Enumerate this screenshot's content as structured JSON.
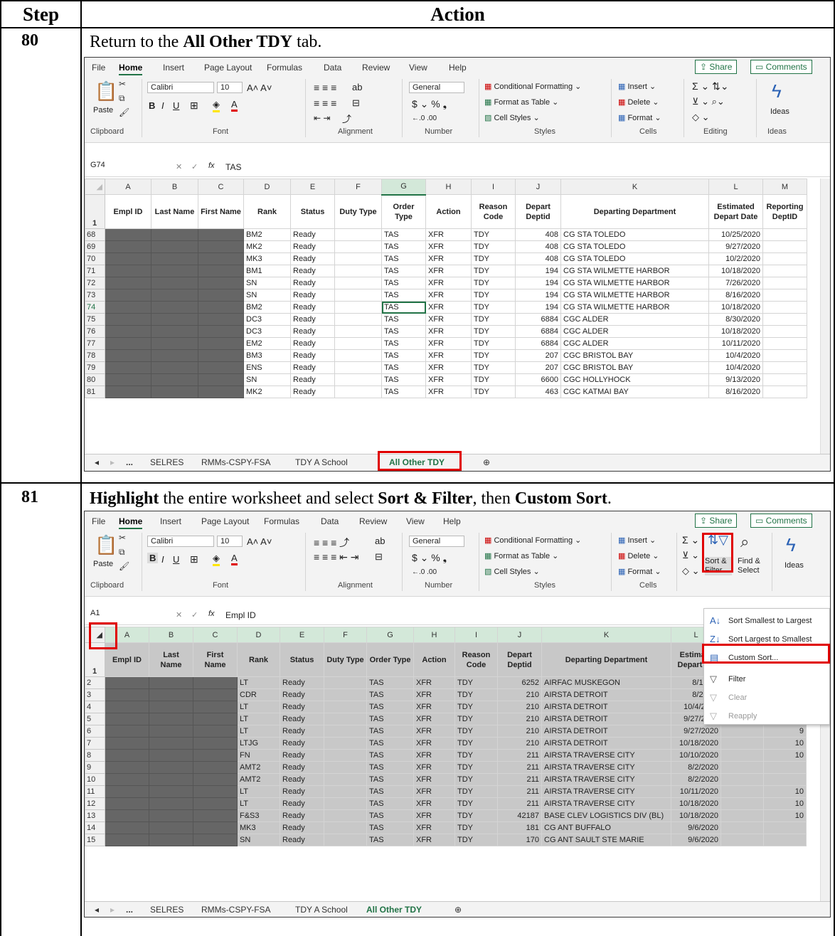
{
  "table_header": {
    "step": "Step",
    "action": "Action"
  },
  "step80": {
    "number": "80",
    "instruction": {
      "pre": "Return to the ",
      "bold": "All Other TDY",
      "post": " tab."
    },
    "excel": {
      "menu": [
        "File",
        "Home",
        "Insert",
        "Page Layout",
        "Formulas",
        "Data",
        "Review",
        "View",
        "Help"
      ],
      "share": "Share",
      "comments": "Comments",
      "ribbon": {
        "paste": "Paste",
        "font_name": "Calibri",
        "font_size": "10",
        "number_format": "General",
        "cond_format": "Conditional Formatting",
        "format_table": "Format as Table",
        "cell_styles": "Cell Styles",
        "insert": "Insert",
        "delete": "Delete",
        "format": "Format",
        "ideas": "Ideas",
        "groups": [
          "Clipboard",
          "Font",
          "Alignment",
          "Number",
          "Styles",
          "Cells",
          "Editing",
          "Ideas"
        ]
      },
      "name_box": "G74",
      "formula": "TAS",
      "col_letters": [
        "A",
        "B",
        "C",
        "D",
        "E",
        "F",
        "G",
        "H",
        "I",
        "J",
        "K",
        "L",
        "M"
      ],
      "headers": [
        "Empl ID",
        "Last Name",
        "First Name",
        "Rank",
        "Status",
        "Duty Type",
        "Order Type",
        "Action",
        "Reason Code",
        "Depart Deptid",
        "Departing Department",
        "Estimated Depart Date",
        "Reporting DeptID"
      ],
      "header_row_num": "1",
      "rows": [
        {
          "n": "68",
          "rank": "BM2",
          "status": "Ready",
          "order": "TAS",
          "action": "XFR",
          "reason": "TDY",
          "deptid": "408",
          "dept": "CG STA TOLEDO",
          "date": "10/25/2020"
        },
        {
          "n": "69",
          "rank": "MK2",
          "status": "Ready",
          "order": "TAS",
          "action": "XFR",
          "reason": "TDY",
          "deptid": "408",
          "dept": "CG STA TOLEDO",
          "date": "9/27/2020"
        },
        {
          "n": "70",
          "rank": "MK3",
          "status": "Ready",
          "order": "TAS",
          "action": "XFR",
          "reason": "TDY",
          "deptid": "408",
          "dept": "CG STA TOLEDO",
          "date": "10/2/2020"
        },
        {
          "n": "71",
          "rank": "BM1",
          "status": "Ready",
          "order": "TAS",
          "action": "XFR",
          "reason": "TDY",
          "deptid": "194",
          "dept": "CG STA WILMETTE HARBOR",
          "date": "10/18/2020"
        },
        {
          "n": "72",
          "rank": "SN",
          "status": "Ready",
          "order": "TAS",
          "action": "XFR",
          "reason": "TDY",
          "deptid": "194",
          "dept": "CG STA WILMETTE HARBOR",
          "date": "7/26/2020"
        },
        {
          "n": "73",
          "rank": "SN",
          "status": "Ready",
          "order": "TAS",
          "action": "XFR",
          "reason": "TDY",
          "deptid": "194",
          "dept": "CG STA WILMETTE HARBOR",
          "date": "8/16/2020"
        },
        {
          "n": "74",
          "rank": "BM2",
          "status": "Ready",
          "order": "TAS",
          "action": "XFR",
          "reason": "TDY",
          "deptid": "194",
          "dept": "CG STA WILMETTE HARBOR",
          "date": "10/18/2020"
        },
        {
          "n": "75",
          "rank": "DC3",
          "status": "Ready",
          "order": "TAS",
          "action": "XFR",
          "reason": "TDY",
          "deptid": "6884",
          "dept": "CGC ALDER",
          "date": "8/30/2020"
        },
        {
          "n": "76",
          "rank": "DC3",
          "status": "Ready",
          "order": "TAS",
          "action": "XFR",
          "reason": "TDY",
          "deptid": "6884",
          "dept": "CGC ALDER",
          "date": "10/18/2020"
        },
        {
          "n": "77",
          "rank": "EM2",
          "status": "Ready",
          "order": "TAS",
          "action": "XFR",
          "reason": "TDY",
          "deptid": "6884",
          "dept": "CGC ALDER",
          "date": "10/11/2020"
        },
        {
          "n": "78",
          "rank": "BM3",
          "status": "Ready",
          "order": "TAS",
          "action": "XFR",
          "reason": "TDY",
          "deptid": "207",
          "dept": "CGC BRISTOL BAY",
          "date": "10/4/2020"
        },
        {
          "n": "79",
          "rank": "ENS",
          "status": "Ready",
          "order": "TAS",
          "action": "XFR",
          "reason": "TDY",
          "deptid": "207",
          "dept": "CGC BRISTOL BAY",
          "date": "10/4/2020"
        },
        {
          "n": "80",
          "rank": "SN",
          "status": "Ready",
          "order": "TAS",
          "action": "XFR",
          "reason": "TDY",
          "deptid": "6600",
          "dept": "CGC HOLLYHOCK",
          "date": "9/13/2020"
        },
        {
          "n": "81",
          "rank": "MK2",
          "status": "Ready",
          "order": "TAS",
          "action": "XFR",
          "reason": "TDY",
          "deptid": "463",
          "dept": "CGC KATMAI BAY",
          "date": "8/16/2020"
        }
      ],
      "tabs": [
        "...",
        "SELRES",
        "RMMs-CSPY-FSA",
        "TDY A School",
        "All Other TDY"
      ]
    }
  },
  "step81": {
    "number": "81",
    "instruction": {
      "b1": "Highlight",
      "t1": " the entire worksheet and select ",
      "b2": "Sort & Filter",
      "t2": ", then ",
      "b3": "Custom Sort",
      "t3": "."
    },
    "excel": {
      "name_box": "A1",
      "formula": "Empl ID",
      "sort_filter": "Sort & Filter",
      "find_select": "Find & Select",
      "dropdown": [
        {
          "label": "Sort Smallest to Largest",
          "icon": "sort-asc-icon",
          "glyph": "A↓"
        },
        {
          "label": "Sort Largest to Smallest",
          "icon": "sort-desc-icon",
          "glyph": "Z↓"
        },
        {
          "label": "Custom Sort...",
          "icon": "custom-sort-icon",
          "glyph": "▤"
        },
        {
          "label": "Filter",
          "icon": "filter-icon",
          "glyph": "▽"
        },
        {
          "label": "Clear",
          "icon": "clear-filter-icon",
          "glyph": "▽"
        },
        {
          "label": "Reapply",
          "icon": "reapply-icon",
          "glyph": "▽"
        }
      ],
      "header_l": "Estimate Depart Da",
      "rows": [
        {
          "n": "2",
          "rank": "LT",
          "status": "Ready",
          "order": "TAS",
          "action": "XFR",
          "reason": "TDY",
          "deptid": "6252",
          "dept": "AIRFAC MUSKEGON",
          "date": "8/16/20",
          "m": ""
        },
        {
          "n": "3",
          "rank": "CDR",
          "status": "Ready",
          "order": "TAS",
          "action": "XFR",
          "reason": "TDY",
          "deptid": "210",
          "dept": "AIRSTA DETROIT",
          "date": "8/21/20",
          "m": ""
        },
        {
          "n": "4",
          "rank": "LT",
          "status": "Ready",
          "order": "TAS",
          "action": "XFR",
          "reason": "TDY",
          "deptid": "210",
          "dept": "AIRSTA DETROIT",
          "date": "10/4/2020",
          "m": "1"
        },
        {
          "n": "5",
          "rank": "LT",
          "status": "Ready",
          "order": "TAS",
          "action": "XFR",
          "reason": "TDY",
          "deptid": "210",
          "dept": "AIRSTA DETROIT",
          "date": "9/27/2020",
          "m": "9"
        },
        {
          "n": "6",
          "rank": "LT",
          "status": "Ready",
          "order": "TAS",
          "action": "XFR",
          "reason": "TDY",
          "deptid": "210",
          "dept": "AIRSTA DETROIT",
          "date": "9/27/2020",
          "m": "9"
        },
        {
          "n": "7",
          "rank": "LTJG",
          "status": "Ready",
          "order": "TAS",
          "action": "XFR",
          "reason": "TDY",
          "deptid": "210",
          "dept": "AIRSTA DETROIT",
          "date": "10/18/2020",
          "m": "10"
        },
        {
          "n": "8",
          "rank": "FN",
          "status": "Ready",
          "order": "TAS",
          "action": "XFR",
          "reason": "TDY",
          "deptid": "211",
          "dept": "AIRSTA TRAVERSE CITY",
          "date": "10/10/2020",
          "m": "10"
        },
        {
          "n": "9",
          "rank": "AMT2",
          "status": "Ready",
          "order": "TAS",
          "action": "XFR",
          "reason": "TDY",
          "deptid": "211",
          "dept": "AIRSTA TRAVERSE CITY",
          "date": "8/2/2020",
          "m": ""
        },
        {
          "n": "10",
          "rank": "AMT2",
          "status": "Ready",
          "order": "TAS",
          "action": "XFR",
          "reason": "TDY",
          "deptid": "211",
          "dept": "AIRSTA TRAVERSE CITY",
          "date": "8/2/2020",
          "m": ""
        },
        {
          "n": "11",
          "rank": "LT",
          "status": "Ready",
          "order": "TAS",
          "action": "XFR",
          "reason": "TDY",
          "deptid": "211",
          "dept": "AIRSTA TRAVERSE CITY",
          "date": "10/11/2020",
          "m": "10"
        },
        {
          "n": "12",
          "rank": "LT",
          "status": "Ready",
          "order": "TAS",
          "action": "XFR",
          "reason": "TDY",
          "deptid": "211",
          "dept": "AIRSTA TRAVERSE CITY",
          "date": "10/18/2020",
          "m": "10"
        },
        {
          "n": "13",
          "rank": "F&S3",
          "status": "Ready",
          "order": "TAS",
          "action": "XFR",
          "reason": "TDY",
          "deptid": "42187",
          "dept": "BASE CLEV LOGISTICS DIV (BL)",
          "date": "10/18/2020",
          "m": "10"
        },
        {
          "n": "14",
          "rank": "MK3",
          "status": "Ready",
          "order": "TAS",
          "action": "XFR",
          "reason": "TDY",
          "deptid": "181",
          "dept": "CG ANT BUFFALO",
          "date": "9/6/2020",
          "m": ""
        },
        {
          "n": "15",
          "rank": "SN",
          "status": "Ready",
          "order": "TAS",
          "action": "XFR",
          "reason": "TDY",
          "deptid": "170",
          "dept": "CG ANT SAULT STE MARIE",
          "date": "9/6/2020",
          "m": ""
        }
      ]
    }
  }
}
